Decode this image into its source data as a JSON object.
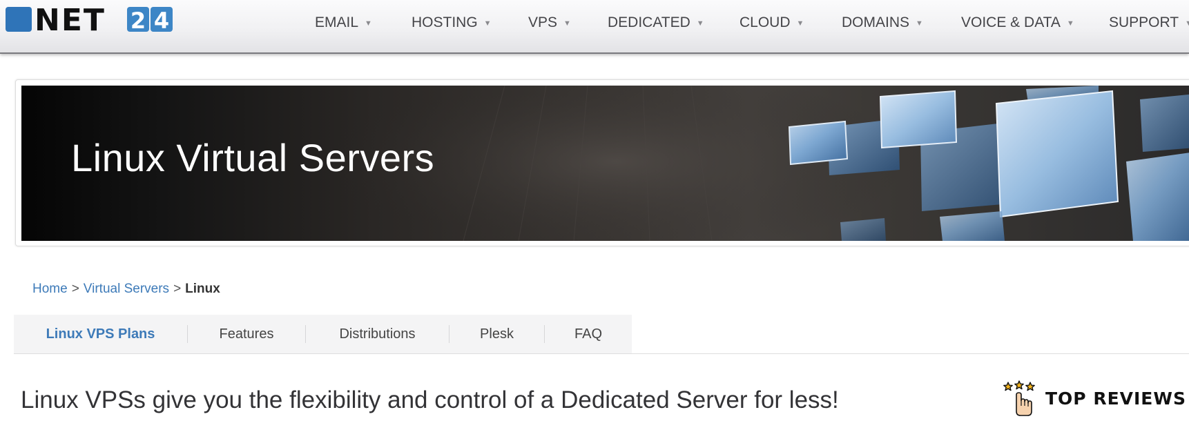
{
  "brand": {
    "logo_text_a": "NET",
    "logo_text_b": "24",
    "logo_colors": {
      "dark": "#111111",
      "blue": "#3d86c6",
      "square": "#2f74b8"
    }
  },
  "nav": {
    "items": [
      {
        "label": "EMAIL"
      },
      {
        "label": "HOSTING"
      },
      {
        "label": "VPS"
      },
      {
        "label": "DEDICATED"
      },
      {
        "label": "CLOUD"
      },
      {
        "label": "DOMAINS"
      },
      {
        "label": "VOICE & DATA"
      },
      {
        "label": "SUPPORT"
      }
    ],
    "caret_icon": "caret-down-icon"
  },
  "hero": {
    "title": "Linux Virtual Servers",
    "art_icon": "floating-screens-illustration"
  },
  "breadcrumb": {
    "home": "Home",
    "virtual_servers": "Virtual Servers",
    "current": "Linux",
    "separator": ">"
  },
  "tabs": {
    "items": [
      {
        "label": "Linux VPS Plans",
        "active": true
      },
      {
        "label": "Features",
        "active": false
      },
      {
        "label": "Distributions",
        "active": false
      },
      {
        "label": "Plesk",
        "active": false
      },
      {
        "label": "FAQ",
        "active": false
      }
    ]
  },
  "main": {
    "headline": "Linux VPSs give you the flexibility and control of a Dedicated Server for less!"
  },
  "reviews": {
    "label": "TOP REVIEWS",
    "icon": "hand-with-stars-icon"
  },
  "colors": {
    "link_blue": "#3d7ab8",
    "nav_text": "#444448",
    "hero_bg": "#2b2826",
    "screen_blue": "#6f9cc9"
  }
}
